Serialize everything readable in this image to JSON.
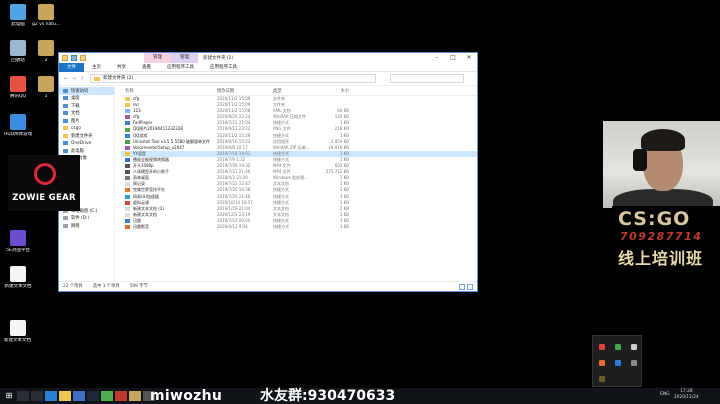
{
  "desktop": {
    "icons": [
      {
        "label": "此电脑",
        "color": "#4ea6e8"
      },
      {
        "label": "g2 vs natu...",
        "color": "#c9a55c"
      },
      {
        "label": "回收站",
        "color": "#9bb6cf"
      },
      {
        "label": "2",
        "color": "#c9a55c"
      },
      {
        "label": "腾讯QQ",
        "color": "#e8503f"
      },
      {
        "label": "1",
        "color": "#c9a55c"
      },
      {
        "label": "HUD简体游戏",
        "color": "#3a8ee0"
      },
      {
        "label": "5E对战平台",
        "color": "#6c4fd1"
      },
      {
        "label": "新建文本文档",
        "color": "#f5f5f5"
      },
      {
        "label": "新建文本文档 (2)",
        "color": "#f5f5f5"
      }
    ]
  },
  "explorer": {
    "context_tabs": {
      "manage_pink": "管理",
      "manage_purple": "管理"
    },
    "title": "新建文件夹 (2)",
    "ribbon_tabs": [
      "文件",
      "主页",
      "共享",
      "查看",
      "应用程序工具",
      "应用程序工具"
    ],
    "address": "新建文件夹 (2)",
    "search_placeholder": "",
    "nav_items": [
      {
        "label": "快速访问",
        "sel": true
      },
      {
        "label": "桌面"
      },
      {
        "label": "下载"
      },
      {
        "label": "文档"
      },
      {
        "label": "图片"
      },
      {
        "label": "csgo"
      },
      {
        "label": "新建文件夹"
      },
      {
        "label": "OneDrive"
      },
      {
        "label": "此电脑"
      },
      {
        "label": "3D 对象"
      },
      {
        "label": "视频"
      },
      {
        "label": "图片"
      },
      {
        "label": "文档"
      },
      {
        "label": "下载"
      },
      {
        "label": "音乐"
      },
      {
        "label": "桌面"
      },
      {
        "label": "本地磁盘 (C:)"
      },
      {
        "label": "软件 (D:)"
      },
      {
        "label": "网络"
      }
    ],
    "columns": {
      "name": "名称",
      "date": "修改日期",
      "type": "类型",
      "size": "大小"
    },
    "files": [
      {
        "name": "cfg",
        "date": "2020/11/2 15:09",
        "type": "文件夹",
        "size": "",
        "icon": "#f3c64d"
      },
      {
        "name": "svr",
        "date": "2020/11/2 15:09",
        "type": "文件夹",
        "size": "",
        "icon": "#f3c64d"
      },
      {
        "name": "123",
        "date": "2020/11/2 15:08",
        "type": "XML 文档",
        "size": "64 KB",
        "icon": "#7fb5e5"
      },
      {
        "name": "cfg",
        "date": "2020/9/20 22:24",
        "type": "WinRAR 压缩文件",
        "size": "134 KB",
        "icon": "#9b5bb5"
      },
      {
        "name": "FadPlayer",
        "date": "2019/7/21 21:04",
        "type": "快捷方式",
        "size": "1 KB",
        "icon": "#3a7bd5"
      },
      {
        "name": "QQ图片20190411232328",
        "date": "2019/4/11 23:22",
        "type": "PNG 文件",
        "size": "218 KB",
        "icon": "#5ea14a"
      },
      {
        "name": "QQ游戏",
        "date": "2020/11/2 15:29",
        "type": "快捷方式",
        "size": "1 KB",
        "icon": "#2d8be0"
      },
      {
        "name": "Uninstall Tool v3.5.5.5580 破解版单文件",
        "date": "2019/6/16 15:23",
        "type": "应用程序",
        "size": "2,859 KB",
        "icon": "#4a9c4a"
      },
      {
        "name": "VoicemeeterSetup_v2047",
        "date": "2019/6/8 10:17",
        "type": "WinRAR ZIP 压缩...",
        "size": "18,916 KB",
        "icon": "#9b5bb5"
      },
      {
        "name": "YY语音",
        "date": "2019/7/18 19:01",
        "type": "快捷方式",
        "size": "1 KB",
        "icon": "#f0c33c",
        "sel": true
      },
      {
        "name": "播放全能视频转换器",
        "date": "2019/7/9 1:32",
        "type": "快捷方式",
        "size": "1 KB",
        "icon": "#3b6fc8"
      },
      {
        "name": "开头1080p",
        "date": "2019/7/30 19:32",
        "type": "MP4 文件",
        "size": "603 KB",
        "icon": "#555"
      },
      {
        "name": "人体模型开的小胖子",
        "date": "2019/7/21 21:46",
        "type": "MP4 文件",
        "size": "275,712 KB",
        "icon": "#555"
      },
      {
        "name": "雨林桌面",
        "date": "2018/4/3 21:20",
        "type": "Windows 批处理...",
        "size": "1 KB",
        "icon": "#777"
      },
      {
        "name": "周记录",
        "date": "2019/7/22 12:47",
        "type": "文本文档",
        "size": "1 KB",
        "icon": "#ddd"
      },
      {
        "name": "完美世界竞技平台",
        "date": "2019/7/20 10:38",
        "type": "快捷方式",
        "size": "1 KB",
        "icon": "#e0792c"
      },
      {
        "name": "网易UU加速器",
        "date": "2019/7/20 21:46",
        "type": "快捷方式",
        "size": "1 KB",
        "icon": "#2aa0d8"
      },
      {
        "name": "虚拟云课",
        "date": "2020/10/14 10:57",
        "type": "快捷方式",
        "size": "1 KB",
        "icon": "#d9433a"
      },
      {
        "name": "新建文本文档 (2)",
        "date": "2019/1/29 21:04",
        "type": "文本文档",
        "size": "2 KB",
        "icon": "#ddd"
      },
      {
        "name": "新建文本文档",
        "date": "2020/12/2 23:19",
        "type": "文本文档",
        "size": "1 KB",
        "icon": "#ddd"
      },
      {
        "name": "迅雷",
        "date": "2019/7/22 20:00",
        "type": "快捷方式",
        "size": "1 KB",
        "icon": "#3a7fd5"
      },
      {
        "name": "迅雷影音",
        "date": "2020/4/12 9:34",
        "type": "快捷方式",
        "size": "1 KB",
        "icon": "#e86a2a"
      }
    ],
    "status": {
      "count": "22 个项目",
      "selected": "选中 1 个项目",
      "size": "599 字节"
    }
  },
  "zowie": {
    "text": "ZOWIE GEAR"
  },
  "csgo": {
    "logo": "CS:GO",
    "qq": "709287714",
    "cn": "线上培训班"
  },
  "taskbar": {
    "brand": "miwozhu",
    "group": "水友群:930470633",
    "lang": "ENG",
    "time": "17:28",
    "date": "2020/11/24"
  }
}
